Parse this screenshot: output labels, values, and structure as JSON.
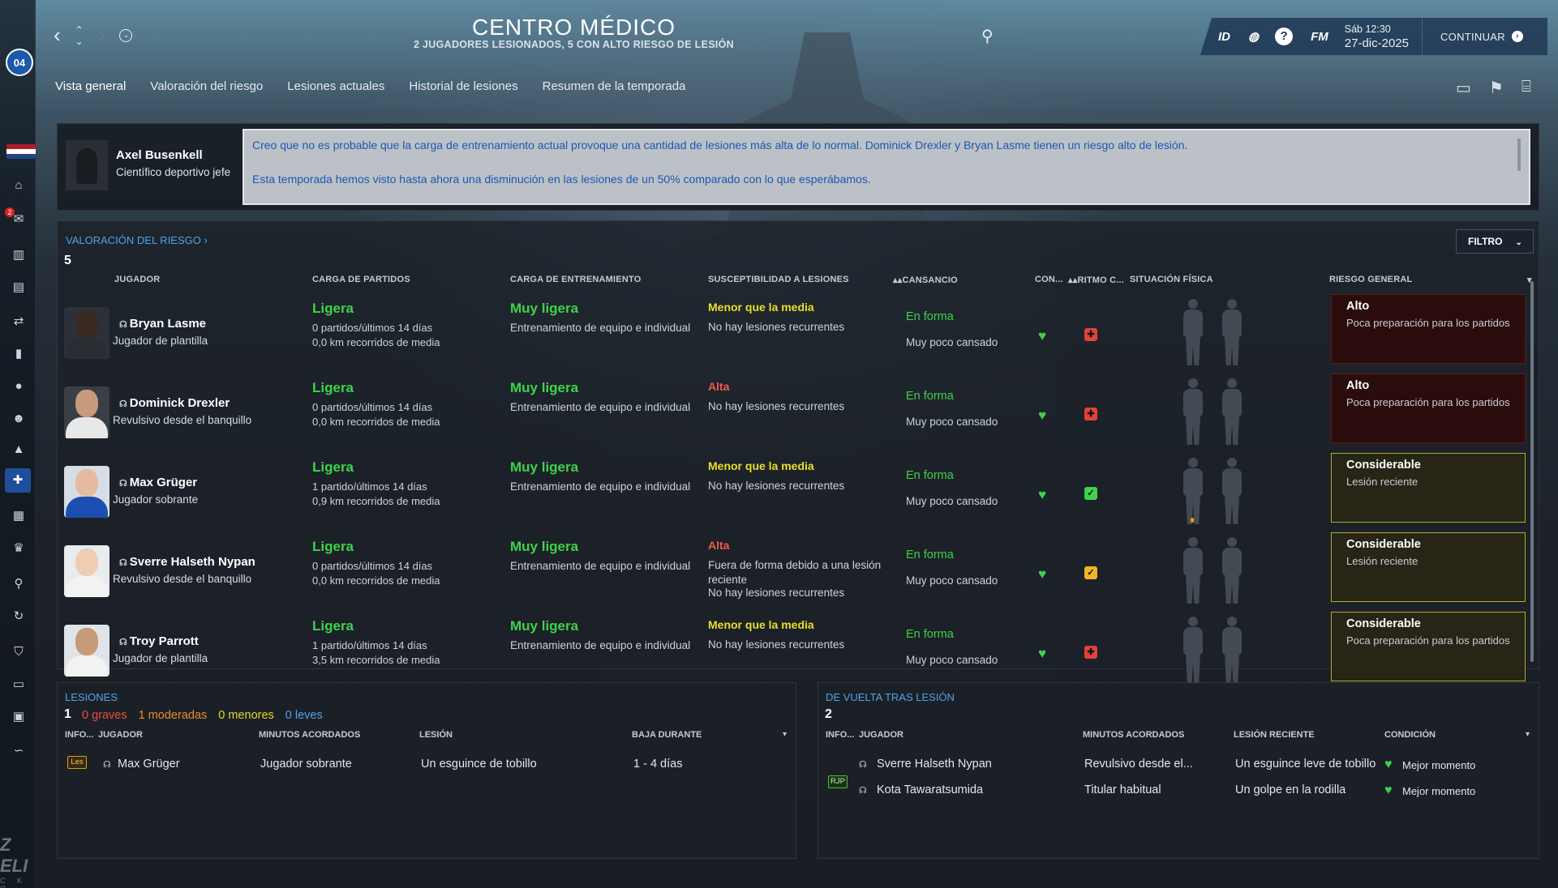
{
  "header": {
    "title": "CENTRO MÉDICO",
    "subtitle": "2 JUGADORES LESIONADOS, 5 CON ALTO RIESGO DE LESIÓN",
    "status_id": "ID",
    "fm_label": "FM",
    "help": "?",
    "day_time": "Sáb 12:30",
    "date": "27-dic-2025",
    "continue_label": "CONTINUAR"
  },
  "sidebar": {
    "club_logo": "04",
    "inbox_badge": "2"
  },
  "tabs": [
    "Vista general",
    "Valoración del riesgo",
    "Lesiones actuales",
    "Historial de lesiones",
    "Resumen de la temporada"
  ],
  "staff": {
    "name": "Axel Busenkell",
    "role": "Científico deportivo jefe",
    "message_1": "Creo que no es probable que la carga de entrenamiento actual provoque una cantidad de lesiones más alta de lo normal. Dominick Drexler y Bryan Lasme tienen un riesgo alto de lesión.",
    "message_2": "Esta temporada hemos visto hasta ahora una disminución en las lesiones de un 50% comparado con lo que esperábamos."
  },
  "risk": {
    "link": "VALORACIÓN DEL RIESGO ›",
    "count": "5",
    "filter": "FILTRO",
    "columns": {
      "player": "JUGADOR",
      "match_load": "CARGA DE PARTIDOS",
      "training_load": "CARGA DE ENTRENAMIENTO",
      "susceptibility": "SUSCEPTIBILIDAD A LESIONES",
      "fatigue": "CANSANCIO",
      "condition": "CON...",
      "rhythm": "RITMO C...",
      "physical": "SITUACIÓN FÍSICA",
      "overall": "RIESGO GENERAL"
    },
    "players": [
      {
        "name": "Bryan Lasme",
        "role": "Jugador de plantilla",
        "load": "Ligera",
        "matches": "0 partidos/últimos 14 días",
        "km": "0,0 km recorridos de media",
        "training": "Muy ligera",
        "training_desc": "Entrenamiento de equipo e individual",
        "sus": "Menor que la media",
        "sus_color": "#e8df2a",
        "sus_lines": [
          "No hay lesiones recurrentes"
        ],
        "fit": "En forma",
        "tired": "Muy poco cansado",
        "rhythm_color": "#e0433a",
        "rhythm_icon": "✚",
        "risk": "Alto",
        "risk_desc": "Poca preparación para los partidos",
        "risk_level": "high"
      },
      {
        "name": "Dominick Drexler",
        "role": "Revulsivo desde el banquillo",
        "load": "Ligera",
        "matches": "0 partidos/últimos 14 días",
        "km": "0,0 km recorridos de media",
        "training": "Muy ligera",
        "training_desc": "Entrenamiento de equipo e individual",
        "sus": "Alta",
        "sus_color": "#ef5b4a",
        "sus_lines": [
          "No hay lesiones recurrentes"
        ],
        "fit": "En forma",
        "tired": "Muy poco cansado",
        "rhythm_color": "#e0433a",
        "rhythm_icon": "✚",
        "risk": "Alto",
        "risk_desc": "Poca preparación para los partidos",
        "risk_level": "high"
      },
      {
        "name": "Max Grüger",
        "role": "Jugador sobrante",
        "load": "Ligera",
        "matches": "1 partido/últimos 14 días",
        "km": "0,9 km recorridos de media",
        "training": "Muy ligera",
        "training_desc": "Entrenamiento de equipo e individual",
        "sus": "Menor que la media",
        "sus_color": "#e8df2a",
        "sus_lines": [
          "No hay lesiones recurrentes"
        ],
        "fit": "En forma",
        "tired": "Muy poco cansado",
        "rhythm_color": "#3fd24a",
        "rhythm_icon": "✓",
        "risk": "Considerable",
        "risk_desc": "Lesión reciente",
        "risk_level": "cons"
      },
      {
        "name": "Sverre Halseth Nypan",
        "role": "Revulsivo desde el banquillo",
        "load": "Ligera",
        "matches": "0 partidos/últimos 14 días",
        "km": "0,0 km recorridos de media",
        "training": "Muy ligera",
        "training_desc": "Entrenamiento de equipo e individual",
        "sus": "Alta",
        "sus_color": "#ef5b4a",
        "sus_lines": [
          "Fuera de forma debido a una lesión reciente",
          "No hay lesiones recurrentes"
        ],
        "fit": "En forma",
        "tired": "Muy poco cansado",
        "rhythm_color": "#f0b32a",
        "rhythm_icon": "✓",
        "risk": "Considerable",
        "risk_desc": "Lesión reciente",
        "risk_level": "cons"
      },
      {
        "name": "Troy Parrott",
        "role": "Jugador de plantilla",
        "load": "Ligera",
        "matches": "1 partido/últimos 14 días",
        "km": "3,5 km recorridos de media",
        "training": "Muy ligera",
        "training_desc": "Entrenamiento de equipo e individual",
        "sus": "Menor que la media",
        "sus_color": "#e8df2a",
        "sus_lines": [
          "No hay lesiones recurrentes"
        ],
        "fit": "En forma",
        "tired": "Muy poco cansado",
        "rhythm_color": "#e0433a",
        "rhythm_icon": "✚",
        "risk": "Considerable",
        "risk_desc": "Poca preparación para los partidos",
        "risk_level": "cons"
      }
    ]
  },
  "injuries": {
    "title": "LESIONES",
    "count": "1",
    "serious": "0 graves",
    "moderate": "1 moderadas",
    "minor": "0 menores",
    "light": "0 leves",
    "columns": {
      "info": "INFO...",
      "player": "JUGADOR",
      "minutes": "MINUTOS ACORDADOS",
      "injury": "LESIÓN",
      "out": "BAJA DURANTE"
    },
    "rows": [
      {
        "tag": "Les",
        "player": "Max Grüger",
        "minutes": "Jugador sobrante",
        "injury": "Un esguince de tobillo",
        "out": "1 - 4 días"
      }
    ]
  },
  "returning": {
    "title": "DE VUELTA TRAS LESIÓN",
    "count": "2",
    "columns": {
      "info": "INFO...",
      "player": "JUGADOR",
      "minutes": "MINUTOS ACORDADOS",
      "recent": "LESIÓN RECIENTE",
      "condition": "CONDICIÓN"
    },
    "rows": [
      {
        "tag": "",
        "player": "Sverre Halseth Nypan",
        "minutes": "Revulsivo desde el...",
        "recent": "Un esguince leve de tobillo",
        "condition": "Mejor momento"
      },
      {
        "tag": "RJP",
        "player": "Kota Tawaratsumida",
        "minutes": "Titular habitual",
        "recent": "Un golpe en la rodilla",
        "condition": "Mejor momento"
      }
    ]
  }
}
